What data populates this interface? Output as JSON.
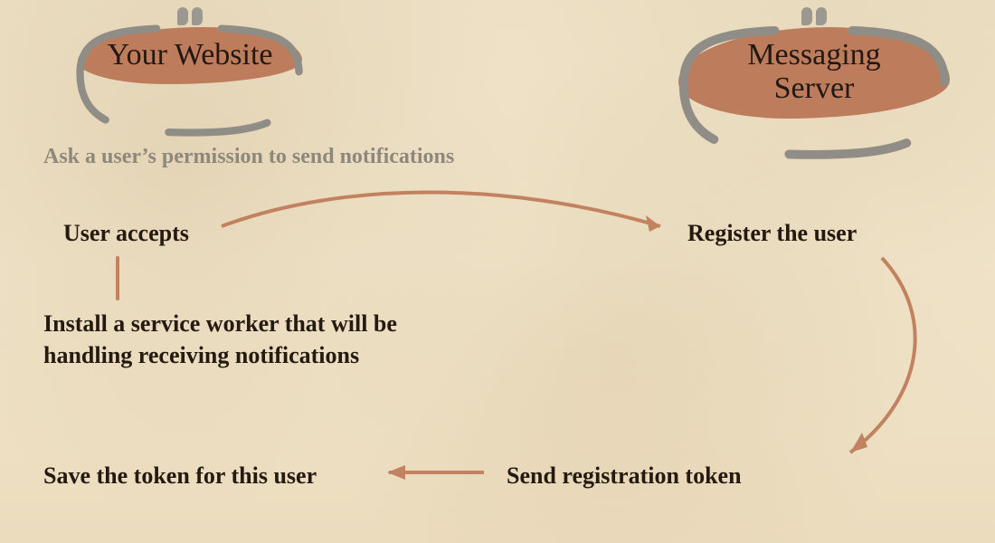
{
  "badges": {
    "left": "Your Website",
    "right": "Messaging Server"
  },
  "subtitle": "Ask a user’s permission to send notifications",
  "steps": {
    "accepts": "User accepts",
    "register": "Register the user",
    "install": "Install a service worker that will be handling receiving notifications",
    "save": "Save the token for this user",
    "send": "Send registration token"
  },
  "colors": {
    "terracotta": "#bd7d5c",
    "arrow": "#c28260",
    "muted": "#8e887c",
    "ink": "#241a10",
    "quote": "#9a9891"
  }
}
